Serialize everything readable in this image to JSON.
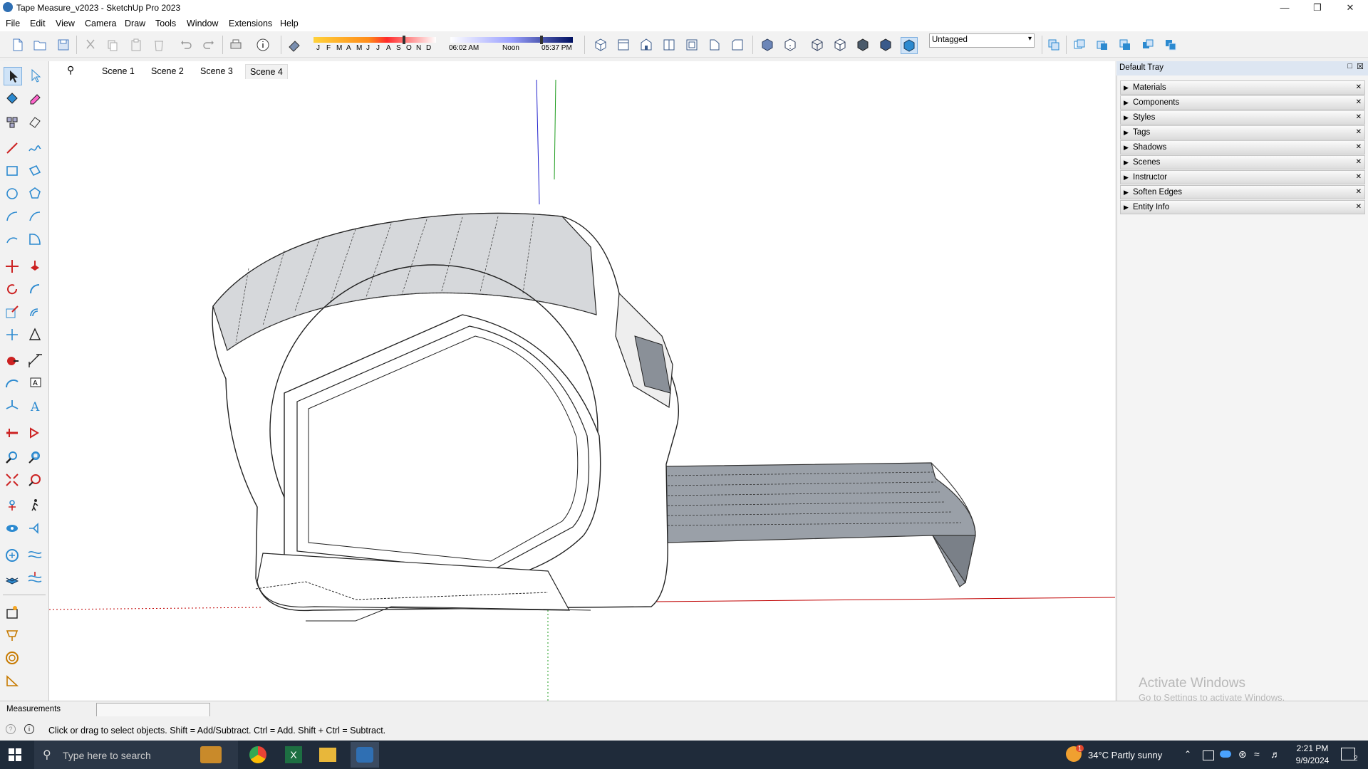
{
  "window": {
    "title": "Tape Measure_v2023 - SketchUp Pro 2023",
    "minimize": "—",
    "maximize": "❒",
    "close": "✕"
  },
  "menu": [
    "File",
    "Edit",
    "View",
    "Camera",
    "Draw",
    "Tools",
    "Window",
    "Extensions",
    "Help"
  ],
  "shadow_bar": {
    "months": [
      "J",
      "F",
      "M",
      "A",
      "M",
      "J",
      "J",
      "A",
      "S",
      "O",
      "N",
      "D"
    ],
    "time_start": "06:02 AM",
    "time_mid": "Noon",
    "time_end": "05:37 PM"
  },
  "tag_select": {
    "value": "Untagged"
  },
  "scenes": {
    "tabs": [
      "Scene 1",
      "Scene 2",
      "Scene 3",
      "Scene 4"
    ],
    "active": "Scene 4"
  },
  "tray": {
    "title": "Default Tray",
    "panels": [
      "Materials",
      "Components",
      "Styles",
      "Tags",
      "Shadows",
      "Scenes",
      "Instructor",
      "Soften Edges",
      "Entity Info"
    ],
    "watermark_line1": "Activate Windows",
    "watermark_line2": "Go to Settings to activate Windows."
  },
  "measurements": {
    "label": "Measurements",
    "value": ""
  },
  "status": {
    "text": "Click or drag to select objects. Shift = Add/Subtract. Ctrl = Add. Shift + Ctrl = Subtract."
  },
  "taskbar": {
    "search_placeholder": "Type here to search",
    "weather": "34°C  Partly sunny",
    "time": "2:21 PM",
    "date": "9/9/2024",
    "notification_count": "2",
    "weather_badge": "1"
  },
  "colors": {
    "accent": "#2f6fb3",
    "axis_red": "#c00000",
    "axis_green": "#1f9d1f",
    "axis_blue": "#2222cc"
  }
}
